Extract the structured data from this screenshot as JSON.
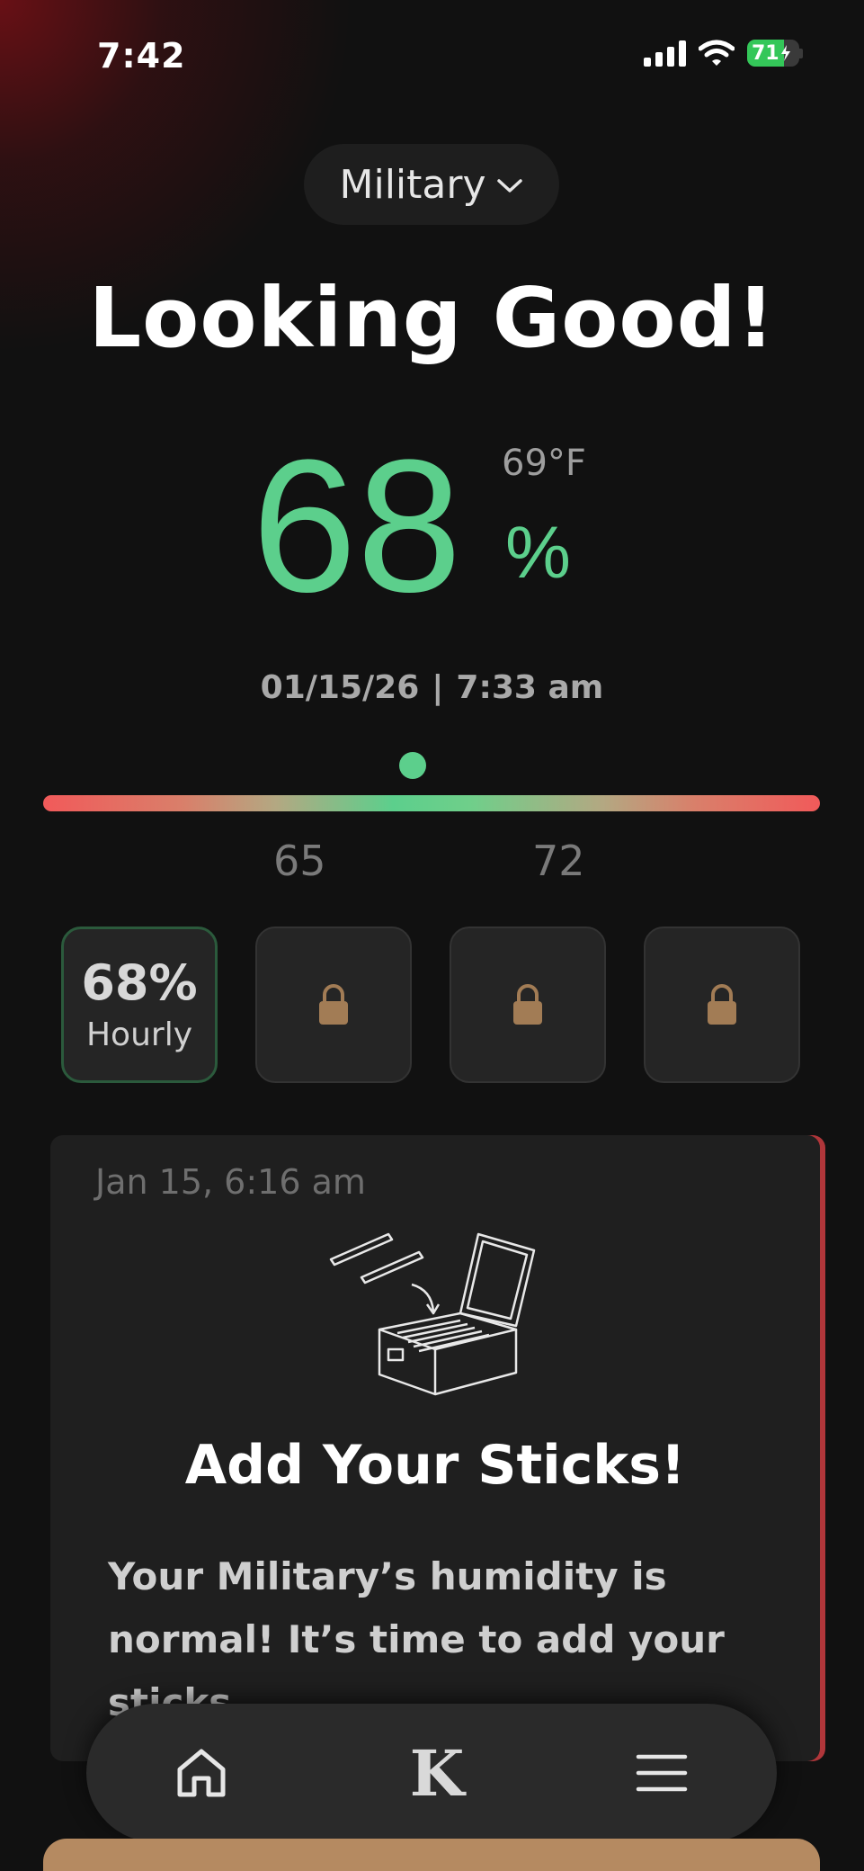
{
  "status_bar": {
    "time": "7:42",
    "battery_level": "71",
    "battery_color": "#34c759"
  },
  "device_selector": {
    "label": "Military",
    "icon": "chevron-down-icon"
  },
  "headline": "Looking Good!",
  "reading": {
    "humidity_value": "68",
    "humidity_unit": "%",
    "temperature": "69°F",
    "date": "01/15/26",
    "separator": "|",
    "time": "7:33 am",
    "accent_color": "#5ccf8c"
  },
  "range": {
    "low_label": "65",
    "high_label": "72",
    "current_value": 68
  },
  "tiles": [
    {
      "value": "68%",
      "label": "Hourly",
      "locked": false
    },
    {
      "icon": "lock-icon",
      "locked": true
    },
    {
      "icon": "lock-icon",
      "locked": true
    },
    {
      "icon": "lock-icon",
      "locked": true
    }
  ],
  "card": {
    "date": "Jan 15, 6:16 am",
    "illustration": "humidor-box-illustration",
    "title": "Add Your Sticks!",
    "body": "Your Military’s humidity is normal! It’s time to add your sticks."
  },
  "nav": {
    "home_icon": "home-icon",
    "brand_letter": "K",
    "menu_icon": "hamburger-menu-icon"
  }
}
